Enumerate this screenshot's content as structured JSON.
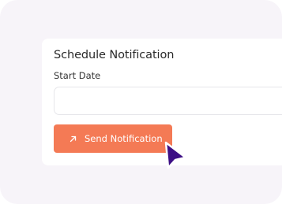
{
  "form": {
    "title": "Schedule Notification",
    "start_date_label": "Start Date",
    "start_date_value": "",
    "send_button_label": "Send Notification",
    "send_button_icon": "arrow-up-right-icon"
  },
  "pointer": {
    "icon": "cursor-arrow-icon"
  },
  "colors": {
    "page_background": "#f7f4f9",
    "button": "#f47a55",
    "cursor": "#3d0f85"
  }
}
